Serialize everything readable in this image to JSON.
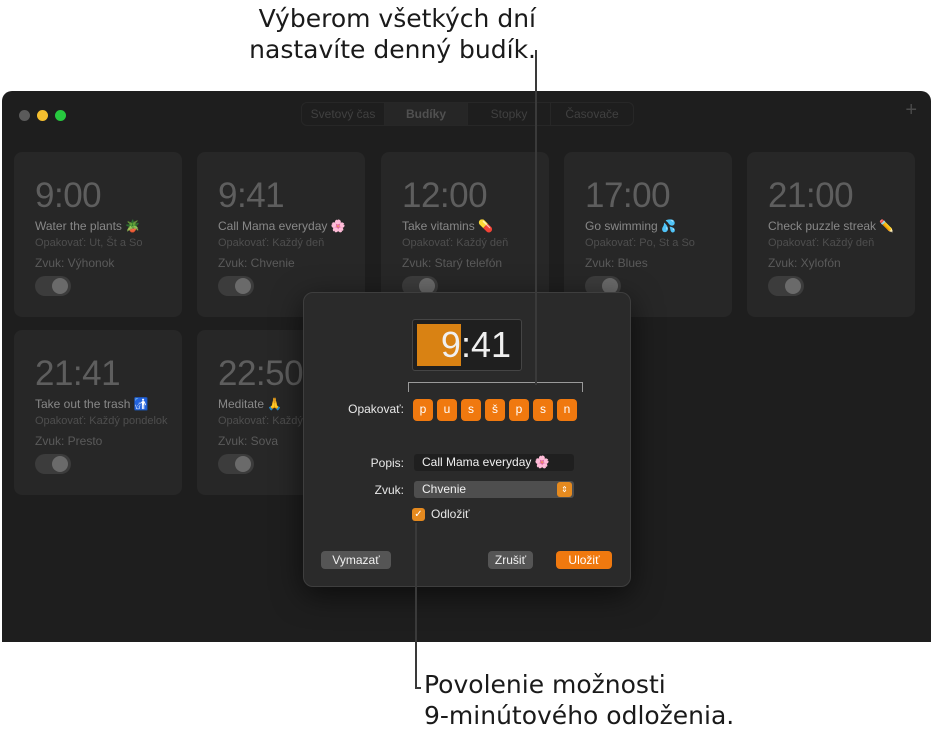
{
  "callouts": {
    "top_line1": "Výberom všetkých dní",
    "top_line2": "nastavíte denný budík.",
    "bottom_line1": "Povolenie možnosti",
    "bottom_line2": "9-minútového odloženia."
  },
  "window": {
    "tabs": [
      "Svetový čas",
      "Budíky",
      "Stopky",
      "Časovače"
    ],
    "active_tab": "Budíky",
    "add_icon": "+"
  },
  "alarms": [
    {
      "time": "9:00",
      "label": "Water the plants 🪴",
      "repeat": "Opakovať: Ut, Št a So",
      "sound": "Zvuk: Výhonok"
    },
    {
      "time": "9:41",
      "label": "Call Mama everyday 🌸",
      "repeat": "Opakovať: Každý deň",
      "sound": "Zvuk: Chvenie"
    },
    {
      "time": "12:00",
      "label": "Take vitamins 💊",
      "repeat": "Opakovať: Každý deň",
      "sound": "Zvuk: Starý telefón"
    },
    {
      "time": "17:00",
      "label": "Go swimming 💦",
      "repeat": "Opakovať: Po, St a So",
      "sound": "Zvuk: Blues"
    },
    {
      "time": "21:00",
      "label": "Check puzzle streak ✏️",
      "repeat": "Opakovať: Každý deň",
      "sound": "Zvuk: Xylofón"
    },
    {
      "time": "21:41",
      "label": "Take out the trash 🚮",
      "repeat": "Opakovať: Každý pondelok",
      "sound": "Zvuk: Presto"
    },
    {
      "time": "22:50",
      "label": "Meditate 🙏",
      "repeat": "Opakovať: Každý deň",
      "sound": "Zvuk: Sova"
    }
  ],
  "dialog": {
    "hour": "9",
    "time_rest": ":41",
    "repeat_label": "Opakovať:",
    "days": [
      "p",
      "u",
      "s",
      "š",
      "p",
      "s",
      "n"
    ],
    "description_label": "Popis:",
    "description_value": "Call Mama everyday 🌸",
    "sound_label": "Zvuk:",
    "sound_value": "Chvenie",
    "snooze_label": "Odložiť",
    "snooze_checked": true,
    "delete_button": "Vymazať",
    "cancel_button": "Zrušiť",
    "save_button": "Uložiť",
    "accent_color": "#f0790f"
  }
}
